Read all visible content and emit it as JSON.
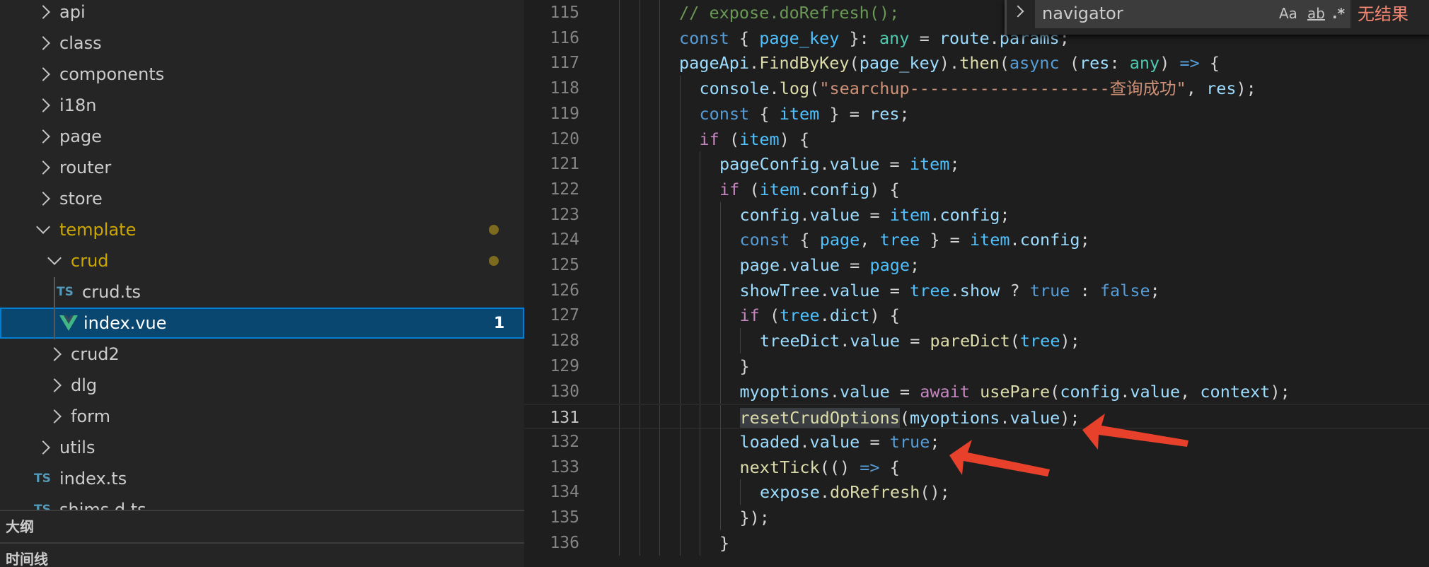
{
  "sidebar": {
    "items": [
      {
        "label": "api",
        "type": "folder",
        "level": 0,
        "open": false
      },
      {
        "label": "class",
        "type": "folder",
        "level": 0,
        "open": false
      },
      {
        "label": "components",
        "type": "folder",
        "level": 0,
        "open": false
      },
      {
        "label": "i18n",
        "type": "folder",
        "level": 0,
        "open": false
      },
      {
        "label": "page",
        "type": "folder",
        "level": 0,
        "open": false
      },
      {
        "label": "router",
        "type": "folder",
        "level": 0,
        "open": false
      },
      {
        "label": "store",
        "type": "folder",
        "level": 0,
        "open": false
      },
      {
        "label": "template",
        "type": "folder",
        "level": 0,
        "open": true,
        "modified": true
      },
      {
        "label": "crud",
        "type": "folder",
        "level": 1,
        "open": true,
        "modified": true
      },
      {
        "label": "crud.ts",
        "type": "ts",
        "level": 2,
        "icon_text": "TS"
      },
      {
        "label": "index.vue",
        "type": "vue",
        "level": 2,
        "selected": true,
        "badge": "1"
      },
      {
        "label": "crud2",
        "type": "folder",
        "level": 1,
        "open": false
      },
      {
        "label": "dlg",
        "type": "folder",
        "level": 1,
        "open": false
      },
      {
        "label": "form",
        "type": "folder",
        "level": 1,
        "open": false
      },
      {
        "label": "utils",
        "type": "folder",
        "level": 0,
        "open": false
      },
      {
        "label": "index.ts",
        "type": "ts",
        "level": -1,
        "icon_text": "TS"
      },
      {
        "label": "shims.d.ts",
        "type": "ts",
        "level": -1,
        "icon_text": "TS"
      }
    ],
    "outline_label": "大纲",
    "timeline_label": "时间线"
  },
  "find_widget": {
    "value": "navigator",
    "match_case": "Aa",
    "whole_word": "ab",
    "regex": ".*",
    "result": "无结果"
  },
  "editor": {
    "current_line": 131,
    "lines": [
      {
        "n": "115",
        "indent": 0,
        "tokens": [
          [
            "cm",
            "// expose.doRefresh();"
          ]
        ]
      },
      {
        "n": "116",
        "indent": 0,
        "tokens": [
          [
            "k",
            "const"
          ],
          [
            "p",
            " { "
          ],
          [
            "cv",
            "page_key"
          ],
          [
            "p",
            " }: "
          ],
          [
            "t",
            "any"
          ],
          [
            "p",
            " = "
          ],
          [
            "v",
            "route"
          ],
          [
            "p",
            "."
          ],
          [
            "v",
            "params"
          ],
          [
            "p",
            ";"
          ]
        ]
      },
      {
        "n": "117",
        "indent": 0,
        "tokens": [
          [
            "v",
            "pageApi"
          ],
          [
            "p",
            "."
          ],
          [
            "f",
            "FindByKey"
          ],
          [
            "p",
            "("
          ],
          [
            "v",
            "page_key"
          ],
          [
            "p",
            ")."
          ],
          [
            "f",
            "then"
          ],
          [
            "p",
            "("
          ],
          [
            "k",
            "async"
          ],
          [
            "p",
            " ("
          ],
          [
            "v",
            "res"
          ],
          [
            "p",
            ": "
          ],
          [
            "t",
            "any"
          ],
          [
            "p",
            ") "
          ],
          [
            "k",
            "=>"
          ],
          [
            "p",
            " {"
          ]
        ]
      },
      {
        "n": "118",
        "indent": 1,
        "tokens": [
          [
            "v",
            "console"
          ],
          [
            "p",
            "."
          ],
          [
            "f",
            "log"
          ],
          [
            "p",
            "("
          ],
          [
            "s",
            "\"searchup--------------------查询成功\""
          ],
          [
            "p",
            ", "
          ],
          [
            "v",
            "res"
          ],
          [
            "p",
            ");"
          ]
        ]
      },
      {
        "n": "119",
        "indent": 1,
        "tokens": [
          [
            "k",
            "const"
          ],
          [
            "p",
            " { "
          ],
          [
            "cv",
            "item"
          ],
          [
            "p",
            " } = "
          ],
          [
            "v",
            "res"
          ],
          [
            "p",
            ";"
          ]
        ]
      },
      {
        "n": "120",
        "indent": 1,
        "tokens": [
          [
            "c",
            "if"
          ],
          [
            "p",
            " ("
          ],
          [
            "cv",
            "item"
          ],
          [
            "p",
            ") {"
          ]
        ]
      },
      {
        "n": "121",
        "indent": 2,
        "tokens": [
          [
            "v",
            "pageConfig"
          ],
          [
            "p",
            "."
          ],
          [
            "v",
            "value"
          ],
          [
            "p",
            " = "
          ],
          [
            "cv",
            "item"
          ],
          [
            "p",
            ";"
          ]
        ]
      },
      {
        "n": "122",
        "indent": 2,
        "tokens": [
          [
            "c",
            "if"
          ],
          [
            "p",
            " ("
          ],
          [
            "cv",
            "item"
          ],
          [
            "p",
            "."
          ],
          [
            "v",
            "config"
          ],
          [
            "p",
            ") {"
          ]
        ]
      },
      {
        "n": "123",
        "indent": 3,
        "tokens": [
          [
            "v",
            "config"
          ],
          [
            "p",
            "."
          ],
          [
            "v",
            "value"
          ],
          [
            "p",
            " = "
          ],
          [
            "cv",
            "item"
          ],
          [
            "p",
            "."
          ],
          [
            "v",
            "config"
          ],
          [
            "p",
            ";"
          ]
        ]
      },
      {
        "n": "124",
        "indent": 3,
        "tokens": [
          [
            "k",
            "const"
          ],
          [
            "p",
            " { "
          ],
          [
            "cv",
            "page"
          ],
          [
            "p",
            ", "
          ],
          [
            "cv",
            "tree"
          ],
          [
            "p",
            " } = "
          ],
          [
            "cv",
            "item"
          ],
          [
            "p",
            "."
          ],
          [
            "v",
            "config"
          ],
          [
            "p",
            ";"
          ]
        ]
      },
      {
        "n": "125",
        "indent": 3,
        "tokens": [
          [
            "v",
            "page"
          ],
          [
            "p",
            "."
          ],
          [
            "v",
            "value"
          ],
          [
            "p",
            " = "
          ],
          [
            "cv",
            "page"
          ],
          [
            "p",
            ";"
          ]
        ]
      },
      {
        "n": "126",
        "indent": 3,
        "tokens": [
          [
            "v",
            "showTree"
          ],
          [
            "p",
            "."
          ],
          [
            "v",
            "value"
          ],
          [
            "p",
            " = "
          ],
          [
            "cv",
            "tree"
          ],
          [
            "p",
            "."
          ],
          [
            "v",
            "show"
          ],
          [
            "p",
            " ? "
          ],
          [
            "k",
            "true"
          ],
          [
            "p",
            " : "
          ],
          [
            "k",
            "false"
          ],
          [
            "p",
            ";"
          ]
        ]
      },
      {
        "n": "127",
        "indent": 3,
        "tokens": [
          [
            "c",
            "if"
          ],
          [
            "p",
            " ("
          ],
          [
            "cv",
            "tree"
          ],
          [
            "p",
            "."
          ],
          [
            "v",
            "dict"
          ],
          [
            "p",
            ") {"
          ]
        ]
      },
      {
        "n": "128",
        "indent": 4,
        "tokens": [
          [
            "v",
            "treeDict"
          ],
          [
            "p",
            "."
          ],
          [
            "v",
            "value"
          ],
          [
            "p",
            " = "
          ],
          [
            "f",
            "pareDict"
          ],
          [
            "p",
            "("
          ],
          [
            "cv",
            "tree"
          ],
          [
            "p",
            ");"
          ]
        ]
      },
      {
        "n": "129",
        "indent": 3,
        "tokens": [
          [
            "p",
            "}"
          ]
        ]
      },
      {
        "n": "130",
        "indent": 3,
        "tokens": [
          [
            "v",
            "myoptions"
          ],
          [
            "p",
            "."
          ],
          [
            "v",
            "value"
          ],
          [
            "p",
            " = "
          ],
          [
            "c",
            "await"
          ],
          [
            "p",
            " "
          ],
          [
            "f",
            "usePare"
          ],
          [
            "p",
            "("
          ],
          [
            "v",
            "config"
          ],
          [
            "p",
            "."
          ],
          [
            "v",
            "value"
          ],
          [
            "p",
            ", "
          ],
          [
            "v",
            "context"
          ],
          [
            "p",
            ");"
          ]
        ]
      },
      {
        "n": "131",
        "indent": 3,
        "tokens": [
          [
            "f hl",
            "resetCrudOptions"
          ],
          [
            "p",
            "("
          ],
          [
            "v",
            "myoptions"
          ],
          [
            "p",
            "."
          ],
          [
            "v",
            "value"
          ],
          [
            "p",
            ");"
          ]
        ]
      },
      {
        "n": "132",
        "indent": 3,
        "tokens": [
          [
            "v",
            "loaded"
          ],
          [
            "p",
            "."
          ],
          [
            "v",
            "value"
          ],
          [
            "p",
            " = "
          ],
          [
            "k",
            "true"
          ],
          [
            "p",
            ";"
          ]
        ]
      },
      {
        "n": "133",
        "indent": 3,
        "tokens": [
          [
            "f",
            "nextTick"
          ],
          [
            "p",
            "(() "
          ],
          [
            "k",
            "=>"
          ],
          [
            "p",
            " {"
          ]
        ]
      },
      {
        "n": "134",
        "indent": 4,
        "tokens": [
          [
            "v",
            "expose"
          ],
          [
            "p",
            "."
          ],
          [
            "f",
            "doRefresh"
          ],
          [
            "p",
            "();"
          ]
        ]
      },
      {
        "n": "135",
        "indent": 3,
        "tokens": [
          [
            "p",
            "});"
          ]
        ]
      },
      {
        "n": "136",
        "indent": 2,
        "tokens": [
          [
            "p",
            "}"
          ]
        ]
      }
    ]
  },
  "annotation_color": "#e8412b"
}
